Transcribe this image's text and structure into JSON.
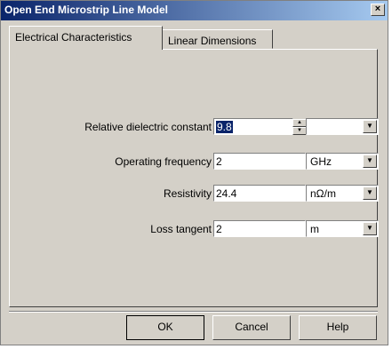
{
  "window": {
    "title": "Open End Microstrip Line Model",
    "close_label": "×"
  },
  "tabs": [
    {
      "label": "Electrical Characteristics",
      "active": true
    },
    {
      "label": "Linear Dimensions",
      "active": false
    }
  ],
  "fields": {
    "dielectric": {
      "label": "Relative dielectric constant",
      "value": "9.8",
      "unit": ""
    },
    "frequency": {
      "label": "Operating frequency",
      "value": "2",
      "unit": "GHz"
    },
    "resistivity": {
      "label": "Resistivity",
      "value": "24.4",
      "unit": "nΩ/m"
    },
    "loss_tangent": {
      "label": "Loss tangent",
      "value": "2",
      "unit": "m"
    }
  },
  "buttons": {
    "ok": "OK",
    "cancel": "Cancel",
    "help": "Help"
  },
  "icons": {
    "spin_up": "▲",
    "spin_down": "▼",
    "dropdown": "▼"
  }
}
